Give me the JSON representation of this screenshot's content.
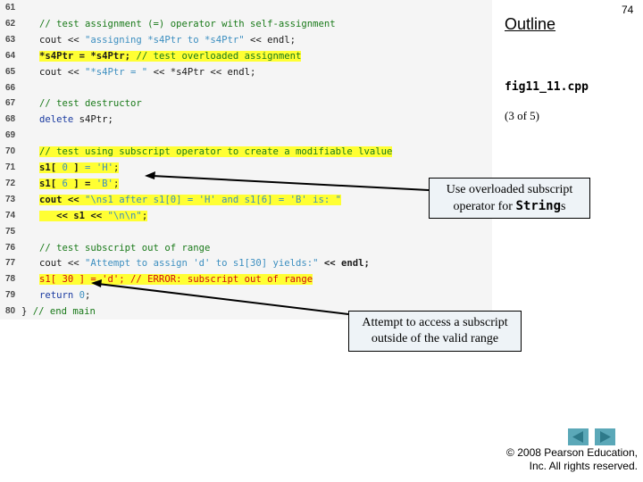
{
  "slide": {
    "page_number": "74",
    "outline_label": "Outline",
    "file_name": "fig11_11.cpp",
    "page_of": "(3 of 5)",
    "copyright_line1": "© 2008 Pearson Education,",
    "copyright_line2": "Inc.  All rights reserved."
  },
  "colors": {
    "highlight": "#ffff33",
    "comment": "#1a7a1a",
    "keyword": "#1a3aa0",
    "string": "#3d8fc0",
    "error": "#d01010",
    "callout_bg": "#eef3f7",
    "nav_button": "#5ba8b8"
  },
  "code": {
    "lines": [
      {
        "num": "61",
        "parts": []
      },
      {
        "num": "62",
        "parts": [
          {
            "t": "// test assignment (=) operator with self-assignment",
            "c": "cmt"
          }
        ]
      },
      {
        "num": "63",
        "parts": [
          {
            "t": "cout << ",
            "c": "plain"
          },
          {
            "t": "\"assigning *s4Ptr to *s4Ptr\"",
            "c": "str"
          },
          {
            "t": " << endl;",
            "c": "plain"
          }
        ]
      },
      {
        "num": "64",
        "parts": [
          {
            "t": "*s4Ptr = *s4Ptr; ",
            "c": "plain",
            "b": true
          },
          {
            "t": "// test overloaded assignment",
            "c": "cmt"
          }
        ],
        "highlight": true
      },
      {
        "num": "65",
        "parts": [
          {
            "t": "cout << ",
            "c": "plain"
          },
          {
            "t": "\"*s4Ptr = \"",
            "c": "str"
          },
          {
            "t": " << *s4Ptr << endl;",
            "c": "plain"
          }
        ]
      },
      {
        "num": "66",
        "parts": []
      },
      {
        "num": "67",
        "parts": [
          {
            "t": "// test destructor",
            "c": "cmt"
          }
        ]
      },
      {
        "num": "68",
        "parts": [
          {
            "t": "delete",
            "c": "kw"
          },
          {
            "t": " s4Ptr;",
            "c": "plain"
          }
        ]
      },
      {
        "num": "69",
        "parts": []
      },
      {
        "num": "70",
        "parts": [
          {
            "t": "// test using subscript operator to create a modifiable lvalue",
            "c": "cmt"
          }
        ],
        "highlight": true
      },
      {
        "num": "71",
        "parts": [
          {
            "t": "s1[ ",
            "c": "plain",
            "b": true
          },
          {
            "t": "0",
            "c": "str"
          },
          {
            "t": " ] ",
            "c": "plain",
            "b": true
          },
          {
            "t": "= ",
            "c": "str"
          },
          {
            "t": "'H'",
            "c": "str"
          },
          {
            "t": ";",
            "c": "plain"
          }
        ],
        "highlight": true
      },
      {
        "num": "72",
        "parts": [
          {
            "t": "s1[ ",
            "c": "plain",
            "b": true
          },
          {
            "t": "6",
            "c": "str"
          },
          {
            "t": " ] = ",
            "c": "plain",
            "b": true
          },
          {
            "t": "'B'",
            "c": "str"
          },
          {
            "t": ";",
            "c": "plain"
          }
        ],
        "highlight": true
      },
      {
        "num": "73",
        "parts": [
          {
            "t": "cout << ",
            "c": "plain",
            "b": true
          },
          {
            "t": "\"\\ns1 after s1[0] = 'H' and s1[6] = 'B' is: \"",
            "c": "str"
          }
        ],
        "highlight": true
      },
      {
        "num": "74",
        "parts": [
          {
            "t": "   << s1 << ",
            "c": "plain",
            "b": true
          },
          {
            "t": "\"\\n\\n\"",
            "c": "str"
          },
          {
            "t": ";",
            "c": "plain"
          }
        ],
        "highlight": true
      },
      {
        "num": "75",
        "parts": []
      },
      {
        "num": "76",
        "parts": [
          {
            "t": "// test subscript out of range",
            "c": "cmt"
          }
        ]
      },
      {
        "num": "77",
        "parts": [
          {
            "t": "cout << ",
            "c": "plain"
          },
          {
            "t": "\"Attempt to assign 'd' to s1[30] yields:\"",
            "c": "str"
          },
          {
            "t": " << endl;",
            "c": "plain",
            "b": true
          }
        ]
      },
      {
        "num": "78",
        "parts": [
          {
            "t": "s1[ 30 ] = 'd'; // ERROR: subscript out of range",
            "c": "err"
          }
        ],
        "highlight": true
      },
      {
        "num": "79",
        "parts": [
          {
            "t": "return",
            "c": "kw"
          },
          {
            "t": " 0",
            "c": "str"
          },
          {
            "t": ";",
            "c": "plain"
          }
        ]
      },
      {
        "num": "80",
        "parts": [
          {
            "t": "} ",
            "c": "plain"
          },
          {
            "t": "// end main",
            "c": "cmt"
          }
        ],
        "indent0": true
      }
    ]
  },
  "callouts": {
    "subscript_text_before": "Use overloaded subscript",
    "subscript_text_line2_before": "operator for ",
    "subscript_text_mono": "String",
    "subscript_text_after": "s",
    "range_line1": "Attempt to access a subscript",
    "range_line2": "outside of the valid range"
  },
  "navigation": {
    "prev_icon": "triangle-left",
    "next_icon": "triangle-right"
  }
}
